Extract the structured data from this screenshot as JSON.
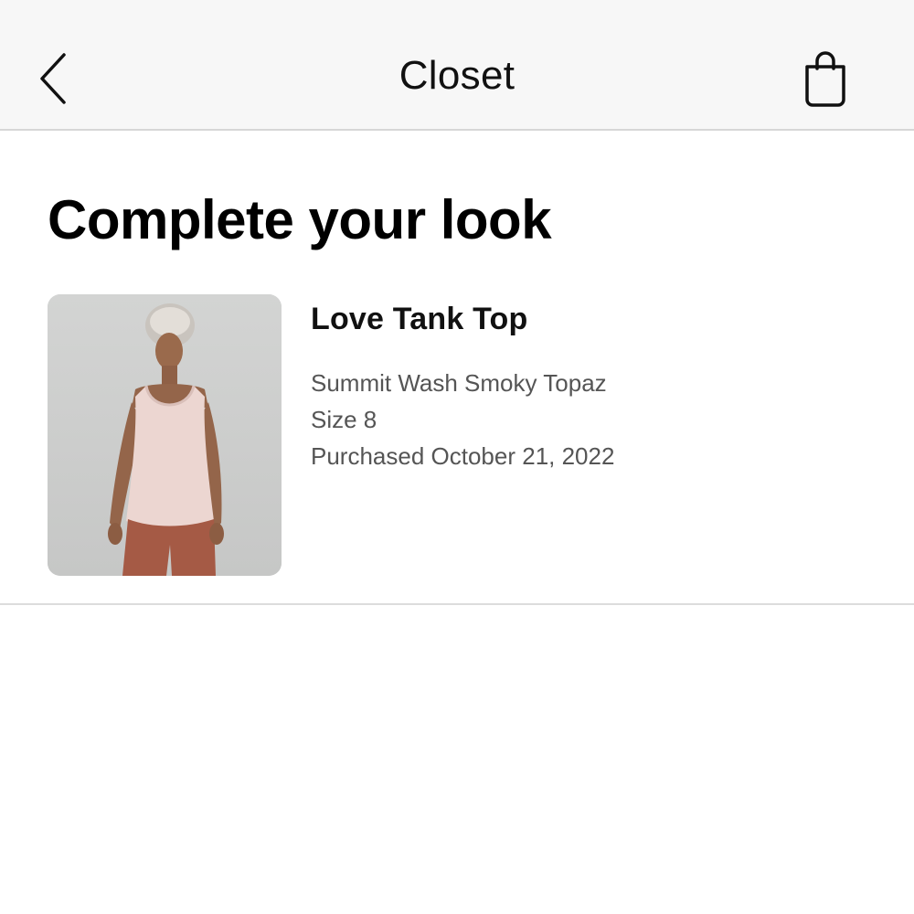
{
  "navbar": {
    "title": "Closet",
    "back_icon": "chevron-left-icon",
    "bag_icon": "shopping-bag-icon"
  },
  "section": {
    "heading": "Complete your look"
  },
  "product": {
    "name": "Love Tank Top",
    "color": "Summit Wash Smoky Topaz",
    "size": "Size 8",
    "purchased": "Purchased October 21, 2022"
  },
  "colors": {
    "navbar_bg": "#f7f7f7",
    "divider": "#d6d6d6",
    "meta_text": "#555555"
  }
}
